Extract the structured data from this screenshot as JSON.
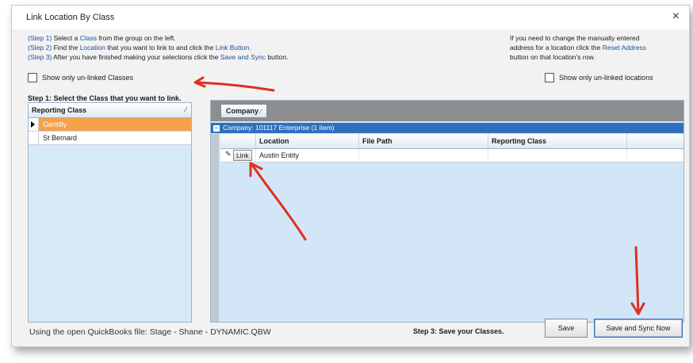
{
  "window": {
    "title": "Link Location By Class",
    "close_glyph": "×"
  },
  "instructions": {
    "s1_prefix": "(Step 1)",
    "s1_a": " Select a ",
    "s1_link": "Class",
    "s1_b": " from the group on the left.",
    "s2_prefix": "(Step 2)",
    "s2_a": " Find the ",
    "s2_link": "Location",
    "s2_b": " that you want to link to and click the ",
    "s2_link2": "Link Button.",
    "s3_prefix": "(Step 3)",
    "s3_a": " After you have finished making your selections click the ",
    "s3_link": "Save and Sync",
    "s3_b": " button."
  },
  "note": {
    "line1": "If you need to change the manually entered",
    "line2a": "address for a location click the ",
    "line2_link": "Reset Address",
    "line3": "button on that location's row."
  },
  "checkbox_left": {
    "label": "Show only un-linked Classes",
    "checked": false
  },
  "checkbox_right": {
    "label": "Show only un-linked locations",
    "checked": false
  },
  "step1_label": "Step 1: Select the Class that you want to link.",
  "left_grid": {
    "header": "Reporting Class",
    "rows": [
      {
        "label": "Gentilly",
        "selected": true
      },
      {
        "label": "St Bernard",
        "selected": false
      }
    ]
  },
  "right_grid": {
    "group_by_chip": "Company",
    "group_row": "Company: 101117 Enterprise (1 item)",
    "columns": [
      "Location",
      "File Path",
      "Reporting Class"
    ],
    "rows": [
      {
        "button": "Link",
        "location": "Austin Entity",
        "file_path": "",
        "reporting_class": ""
      }
    ]
  },
  "footer": {
    "file_text": "Using the open QuickBooks file: Stage - Shane - DYNAMIC.QBW",
    "step3": "Step 3: Save your Classes.",
    "save": "Save",
    "save_sync": "Save and Sync Now"
  },
  "colors": {
    "selected_row": "#f4a24a",
    "group_row": "#2f6fbe",
    "annotation_arrow": "#e0301e"
  }
}
